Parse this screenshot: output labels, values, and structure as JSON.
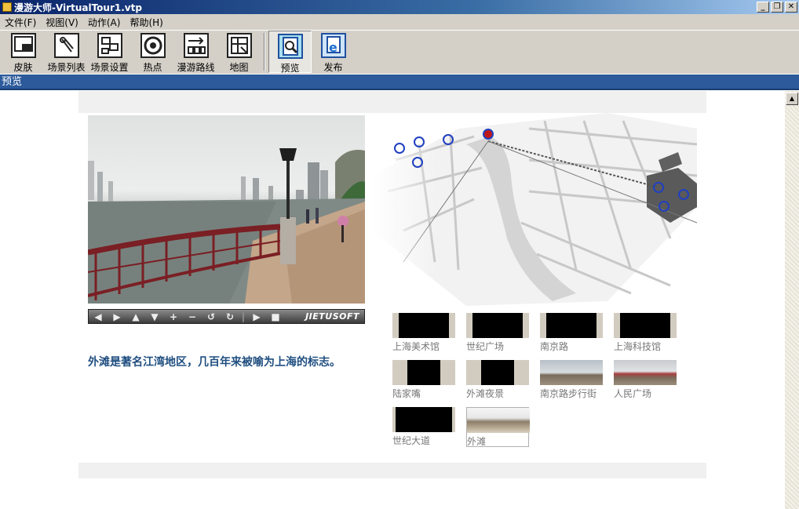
{
  "window": {
    "title": "漫游大师-VirtualTour1.vtp",
    "controls": [
      "_",
      "❐",
      "✕"
    ]
  },
  "menu": [
    "文件(F)",
    "视图(V)",
    "动作(A)",
    "帮助(H)"
  ],
  "toolbar": [
    {
      "label": "皮肤",
      "icon": "skin-icon"
    },
    {
      "label": "场景列表",
      "icon": "scene-list-icon"
    },
    {
      "label": "场景设置",
      "icon": "scene-settings-icon"
    },
    {
      "label": "热点",
      "icon": "hotspot-icon"
    },
    {
      "label": "漫游路线",
      "icon": "tour-route-icon"
    },
    {
      "label": "地图",
      "icon": "map-icon"
    },
    {
      "label": "预览",
      "icon": "preview-icon"
    },
    {
      "label": "发布",
      "icon": "publish-icon"
    }
  ],
  "section_title": "预览",
  "player": {
    "controls": [
      "◀",
      "▶",
      "▲",
      "▼",
      "+",
      "−",
      "↺",
      "↻",
      "▶",
      "■"
    ],
    "brand": "JIETUSOFT"
  },
  "description": "外滩是著名江湾地区，几百年来被喻为上海的标志。",
  "scenes": [
    {
      "label": "上海美术馆",
      "type": "black"
    },
    {
      "label": "世纪广场",
      "type": "black"
    },
    {
      "label": "南京路",
      "type": "black"
    },
    {
      "label": "上海科技馆",
      "type": "black"
    },
    {
      "label": "陆家嘴",
      "type": "black-narrow"
    },
    {
      "label": "外滩夜景",
      "type": "black-narrow"
    },
    {
      "label": "南京路步行街",
      "type": "photo"
    },
    {
      "label": "人民广场",
      "type": "photo"
    },
    {
      "label": "世纪大道",
      "type": "black"
    },
    {
      "label": "外滩",
      "type": "photo",
      "selected": true
    }
  ],
  "colors": {
    "accent": "#2c5a9a",
    "description_text": "#1f4e80",
    "hotspot": "#2040c0",
    "active_hotspot": "#c01818"
  }
}
